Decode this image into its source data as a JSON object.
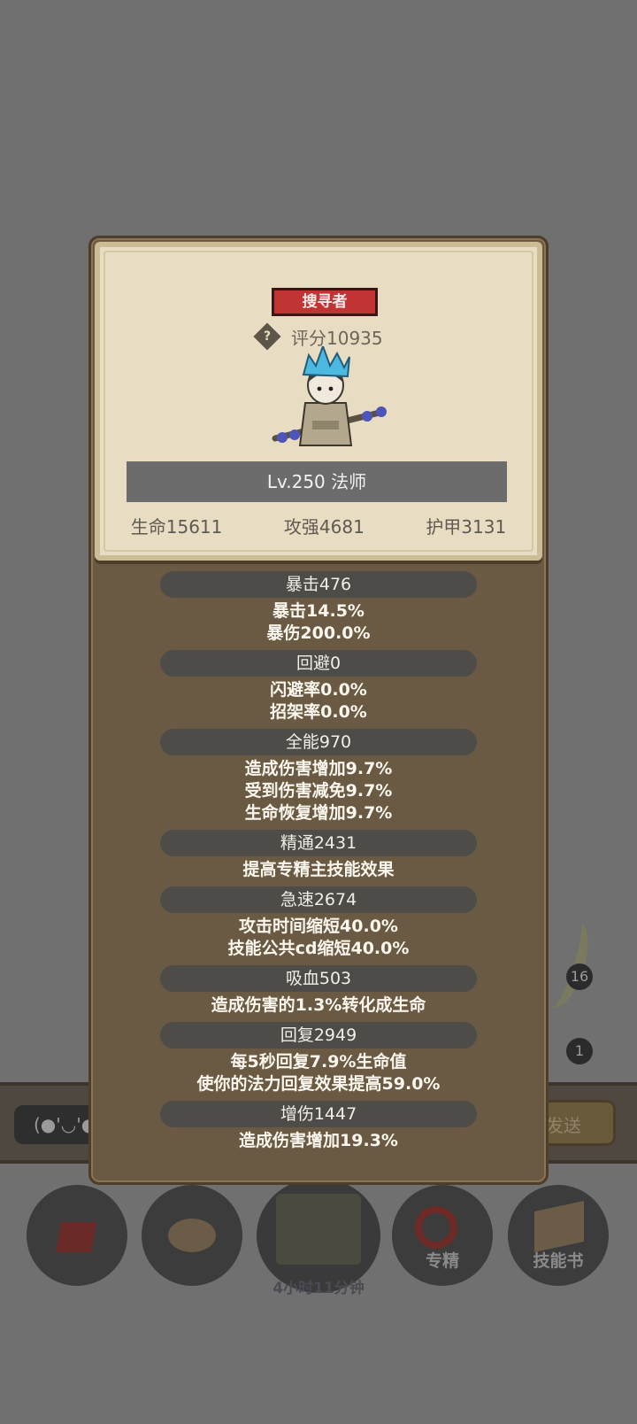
{
  "background": {
    "emoji_button_label": "(●'◡'●",
    "send_button_label": "发送",
    "badge_counts": [
      "16",
      "1"
    ],
    "bottom_buttons": [
      {
        "icon": "gift-box-icon",
        "label": ""
      },
      {
        "icon": "bread-icon",
        "label": ""
      },
      {
        "icon": "treasure-chest-icon",
        "label": ""
      },
      {
        "icon": "target-arrow-icon",
        "label": "专精"
      },
      {
        "icon": "skill-book-icon",
        "label": "技能书"
      }
    ],
    "timer_text": "4小时11分钟"
  },
  "character": {
    "class_badge": "搜寻者",
    "score_text": "评分10935",
    "level_text": "Lv.250 法师",
    "main_stats": [
      "生命15611",
      "攻强4681",
      "护甲3131"
    ]
  },
  "stat_groups": [
    {
      "header": "暴击476",
      "lines": [
        "暴击14.5%",
        "暴伤200.0%"
      ]
    },
    {
      "header": "回避0",
      "lines": [
        "闪避率0.0%",
        "招架率0.0%"
      ]
    },
    {
      "header": "全能970",
      "lines": [
        "造成伤害增加9.7%",
        "受到伤害减免9.7%",
        "生命恢复增加9.7%"
      ]
    },
    {
      "header": "精通2431",
      "lines": [
        "提高专精主技能效果"
      ]
    },
    {
      "header": "急速2674",
      "lines": [
        "攻击时间缩短40.0%",
        "技能公共cd缩短40.0%"
      ]
    },
    {
      "header": "吸血503",
      "lines": [
        "造成伤害的1.3%转化成生命"
      ]
    },
    {
      "header": "回复2949",
      "lines": [
        "每5秒回复7.9%生命值",
        "使你的法力回复效果提高59.0%"
      ]
    },
    {
      "header": "增伤1447",
      "lines": [
        "造成伤害增加19.3%"
      ]
    }
  ],
  "colors": {
    "overlay": "#707070",
    "panel": "#6b5a43",
    "card": "#e8dcc2",
    "badge_red": "#c13434",
    "pill": "#4e4c48"
  }
}
